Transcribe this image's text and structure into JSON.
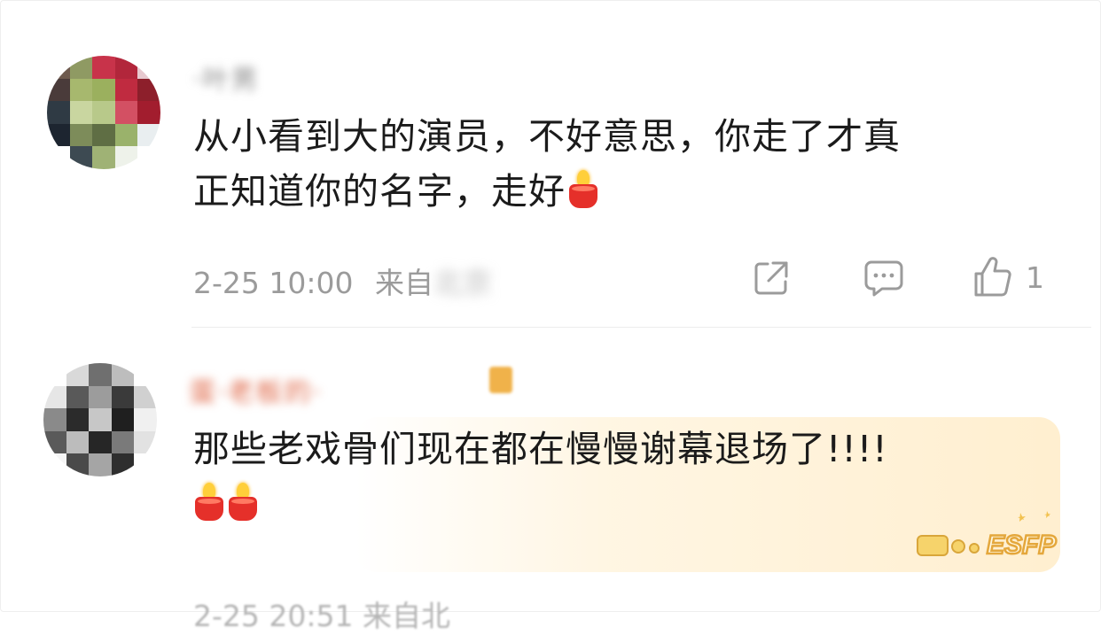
{
  "comments": [
    {
      "username": "·叶男",
      "text_lines": [
        "从小看到大的演员，不好意思，你走了才真",
        "正知道你的名字，走好"
      ],
      "emojis": [
        "candle"
      ],
      "timestamp": "2-25 10:00",
      "location_prefix": "来自",
      "location_blurred": "北京",
      "actions": {
        "share_icon": "share-icon",
        "comment_icon": "comment-icon",
        "like_icon": "thumbs-up-icon",
        "like_count": "1"
      }
    },
    {
      "username": "蛋·老板的·",
      "text_lines": [
        "那些老戏骨们现在都在慢慢谢幕退场了!!!!"
      ],
      "emojis": [
        "candle",
        "candle"
      ],
      "badge_text": "ESFP",
      "cutoff_meta": "2-25 20:51 来自北"
    }
  ],
  "colors": {
    "accent_like": "#9b9b9b",
    "candle_red": "#e5302a",
    "candle_flame": "#ffcf3a",
    "highlight": "#fff1da",
    "badge": "#f0b24a"
  }
}
